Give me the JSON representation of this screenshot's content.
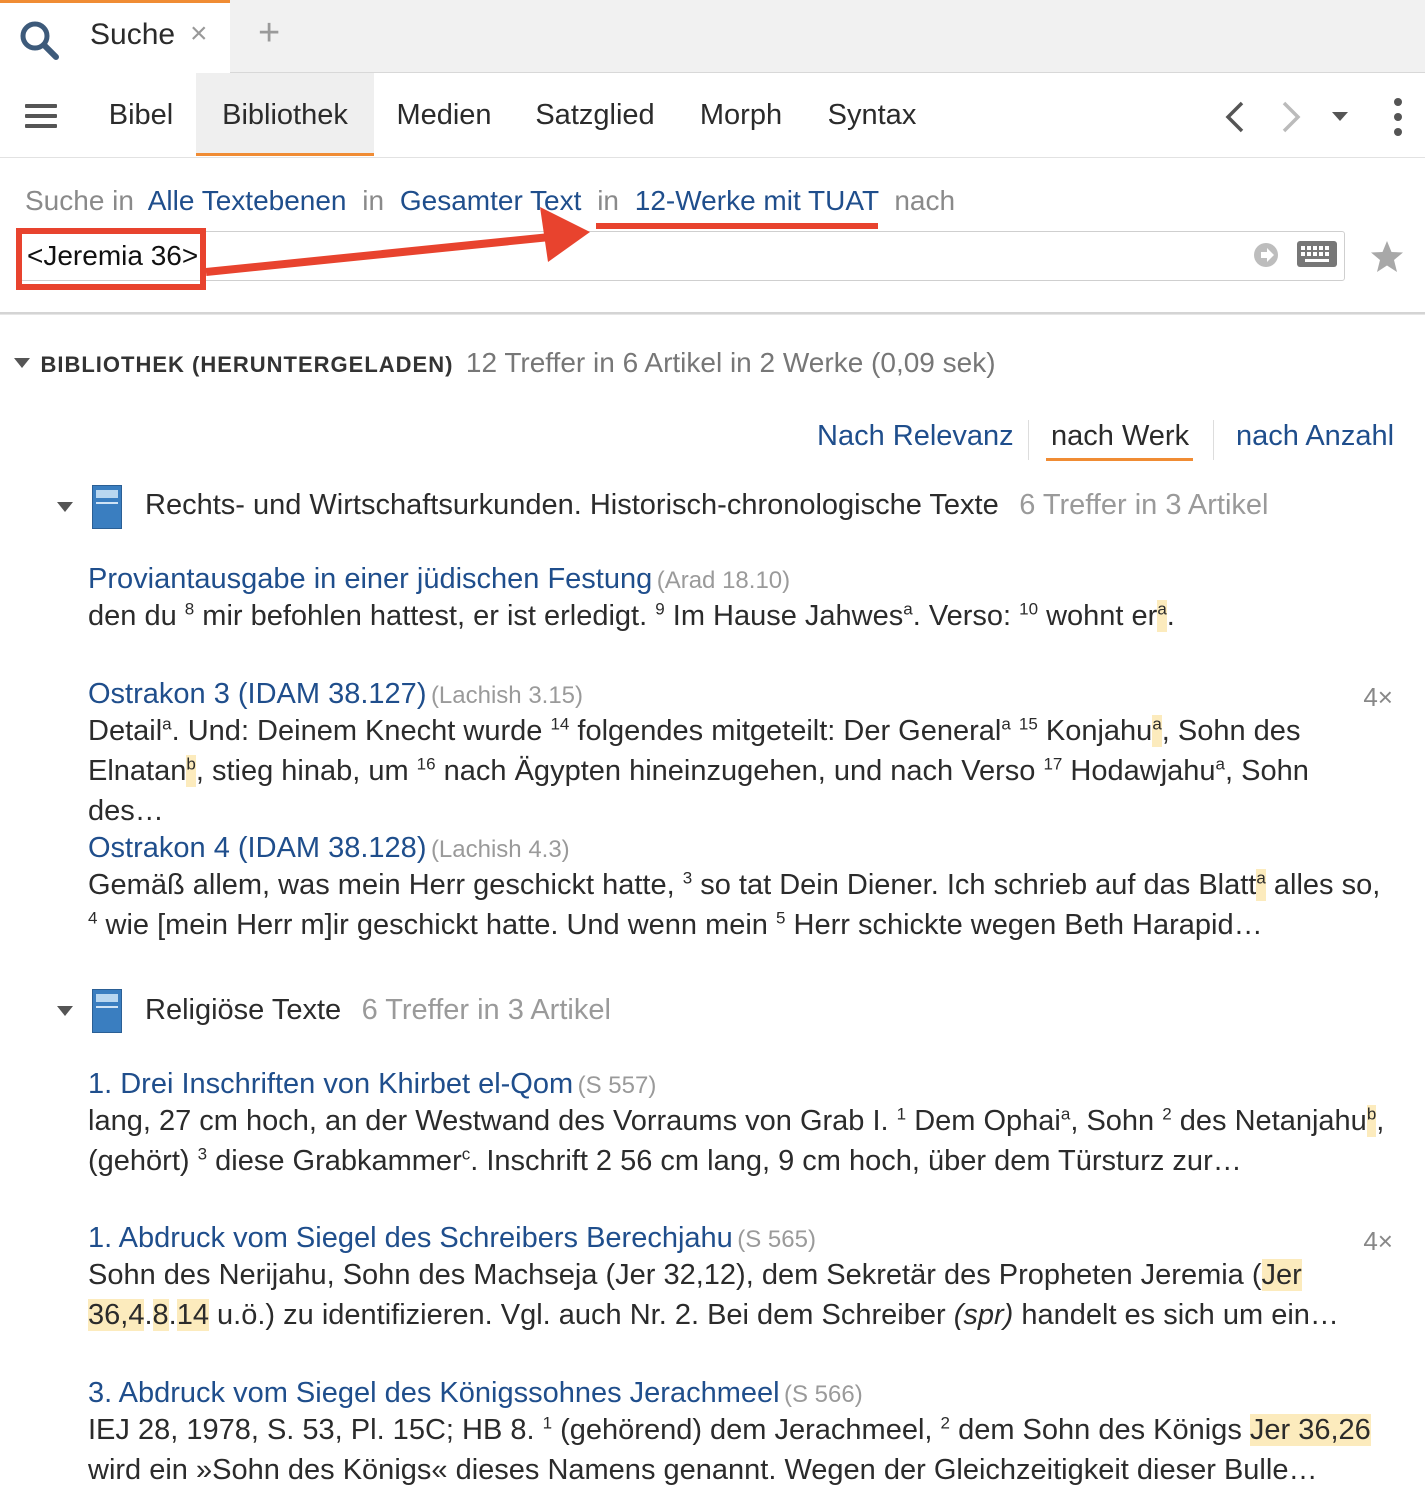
{
  "tab": {
    "label": "Suche",
    "close": "×",
    "add": "+"
  },
  "nav": {
    "tabs": [
      "Bibel",
      "Bibliothek",
      "Medien",
      "Satzglied",
      "Morph",
      "Syntax"
    ],
    "active": "Bibliothek"
  },
  "scope": {
    "prefix": "Suche in",
    "level": "Alle Textebenen",
    "in1": "in",
    "range": "Gesamter Text",
    "in2": "in",
    "collection": "12-Werke mit TUAT",
    "suffix": "nach"
  },
  "search": {
    "query": "<Jeremia 36>"
  },
  "section": {
    "title": "BIBLIOTHEK (HERUNTERGELADEN)",
    "summary": "12 Treffer in 6 Artikel in 2 Werke (0,09 sek)"
  },
  "sort": {
    "options": [
      "Nach Relevanz",
      "nach Werk",
      "nach Anzahl"
    ],
    "active": "nach Werk"
  },
  "groups": [
    {
      "title": "Rechts- und Wirtschaftsurkunden. Historisch-chronologische Texte",
      "count": "6 Treffer in 3 Artikel",
      "results": [
        {
          "title": "Proviantausgabe in einer jüdischen Festung",
          "ref": "(Arad 18.10)",
          "snippet_html": "den du <sup>8</sup> mir befohlen hattest, er ist erledigt. <sup>9</sup> Im Hause Jahwes<sup>a</sup>. Verso: <sup>10</sup> wohnt er<span class=\"hl\"><sup>a</sup></span>."
        },
        {
          "title": "Ostrakon 3 (IDAM 38.127)",
          "ref": "(Lachish 3.15)",
          "count": "4×",
          "snippet_html": "Detail<sup>a</sup>. Und: Deinem Knecht wurde <sup>14</sup> folgendes mitgeteilt: Der General<sup>a</sup> <sup>15</sup> Konjahu<span class=\"hl\"><sup>a</sup></span>, Sohn des Elnatan<span class=\"hl\"><sup>b</sup></span>, stieg hinab, um <sup>16</sup> nach Ägypten hineinzugehen, und nach Verso <sup>17</sup> Hodawjahu<sup>a</sup>, Sohn des…"
        },
        {
          "title": "Ostrakon 4 (IDAM 38.128)",
          "ref": "(Lachish 4.3)",
          "snippet_html": "Gemäß allem, was mein Herr geschickt hatte, <sup>3</sup> so tat Dein Diener. Ich schrieb auf das Blatt<span class=\"hl\"><sup>a</sup></span> alles so, <sup>4</sup> wie [mein Herr m]ir geschickt hatte. Und wenn mein <sup>5</sup> Herr schickte wegen Beth Harapid…"
        }
      ]
    },
    {
      "title": "Religiöse Texte",
      "count": "6 Treffer in 3 Artikel",
      "results": [
        {
          "title": "1. Drei Inschriften von Khirbet el-Qom",
          "ref": "(S 557)",
          "snippet_html": "lang, 27 cm hoch, an der Westwand des Vorraums von Grab I. <sup>1</sup> Dem Ophai<sup>a</sup>, Sohn <sup>2</sup> des Netanjahu<span class=\"hl\"><sup>b</sup></span>, (gehört) <sup>3</sup> diese Grabkammer<sup>c</sup>. Inschrift 2 56 cm lang, 9 cm hoch, über dem Türsturz zur…"
        },
        {
          "title": "1. Abdruck vom Siegel des Schreibers Berechjahu",
          "ref": "(S 565)",
          "count": "4×",
          "snippet_html": "Sohn des Nerijahu, Sohn des Machseja (Jer 32,12), dem Sekretär des Propheten Jeremia (<span class=\"hl\">Jer 36,4</span>.<span class=\"hl\">8</span>.<span class=\"hl\">14</span> u.ö.) zu identifizieren. Vgl. auch Nr. 2. Bei dem Schreiber <i>(spr)</i> handelt es sich um ein…"
        },
        {
          "title": "3. Abdruck vom Siegel des Königssohnes Jerachmeel",
          "ref": "(S 566)",
          "snippet_html": "IEJ 28, 1978, S. 53, Pl. 15C; HB 8. <sup>1</sup> (gehörend) dem Jerachmeel, <sup>2</sup> dem Sohn des Königs <span class=\"hl\">Jer 36,26</span> wird ein »Sohn des Königs« dieses Namens genannt. Wegen der Gleichzeitigkeit dieser Bulle…"
        }
      ]
    }
  ],
  "colors": {
    "accent": "#f08c34",
    "link": "#1f4e8c",
    "highlight": "#fcebbd",
    "annotation": "#e8432e"
  }
}
